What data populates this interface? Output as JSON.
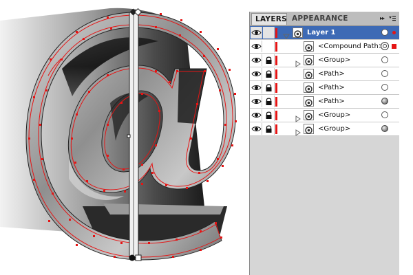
{
  "panel": {
    "tabs": [
      {
        "label": "LAYERS",
        "active": true
      },
      {
        "label": "APPEARANCE",
        "active": false
      }
    ],
    "menu_arrows": "▸▸",
    "menu_icon": "panel-menu-icon"
  },
  "layers": [
    {
      "label": "Layer 1",
      "level": 0,
      "expanded": true,
      "selected": true,
      "visible": true,
      "locked": false,
      "target": "outline",
      "indicator": "dot"
    },
    {
      "label": "<Compound Path>",
      "level": 1,
      "expanded": false,
      "visible": true,
      "locked": false,
      "target": "double",
      "indicator": "square"
    },
    {
      "label": "<Group>",
      "level": 1,
      "has_children": true,
      "visible": true,
      "locked": true,
      "target": "outline"
    },
    {
      "label": "<Path>",
      "level": 1,
      "visible": true,
      "locked": true,
      "target": "outline"
    },
    {
      "label": "<Path>",
      "level": 1,
      "visible": true,
      "locked": true,
      "target": "outline"
    },
    {
      "label": "<Path>",
      "level": 1,
      "visible": true,
      "locked": true,
      "target": "filled"
    },
    {
      "label": "<Group>",
      "level": 1,
      "has_children": true,
      "visible": true,
      "locked": true,
      "target": "outline"
    },
    {
      "label": "<Group>",
      "level": 1,
      "has_children": true,
      "visible": true,
      "locked": true,
      "target": "filled"
    }
  ],
  "colors": {
    "layer_color": "#e51414",
    "selection_blue": "#3d6ab5",
    "panel_bg": "#d6d6d6",
    "path_outline": "#e51414"
  },
  "artwork": {
    "symbol": "@",
    "description_icon": "at-sign-3d-artwork"
  }
}
